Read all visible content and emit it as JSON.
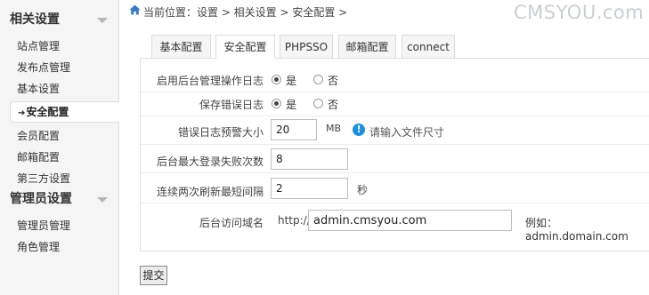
{
  "sidebar": {
    "section1_title": "相关设置",
    "items": [
      "站点管理",
      "发布点管理",
      "基本设置",
      "安全配置",
      "会员配置",
      "邮箱配置",
      "第三方设置"
    ],
    "active_arrow": "➔",
    "section2_title": "管理员设置",
    "items2": [
      "管理员管理",
      "角色管理"
    ]
  },
  "breadcrumb": "当前位置：设置 > 相关设置 > 安全配置 >",
  "watermark": "CMSYOU.com",
  "tabs": [
    "基本配置",
    "安全配置",
    "PHPSSO",
    "邮箱配置",
    "connect"
  ],
  "form": {
    "admin_log": {
      "label": "启用后台管理操作日志",
      "yes": "是",
      "no": "否",
      "selected": "是"
    },
    "error_log": {
      "label": "保存错误日志",
      "yes": "是",
      "no": "否",
      "selected": "是"
    },
    "error_log_size": {
      "label": "错误日志预警大小",
      "value": "20",
      "unit": "MB",
      "hint": "请输入文件尺寸"
    },
    "max_login_fail": {
      "label": "后台最大登录失败次数",
      "value": "8"
    },
    "refresh_interval": {
      "label": "连续两次刷新最短间隔",
      "value": "2",
      "unit": "秒"
    },
    "admin_domain": {
      "label": "后台访问域名",
      "prefix": "http://",
      "value": "admin.cmsyou.com",
      "example": "例如：admin.domain.com"
    }
  },
  "submit_label": "提交",
  "colors": {
    "info_icon": "#1e90e0",
    "home_icon": "#3a7bc8"
  }
}
